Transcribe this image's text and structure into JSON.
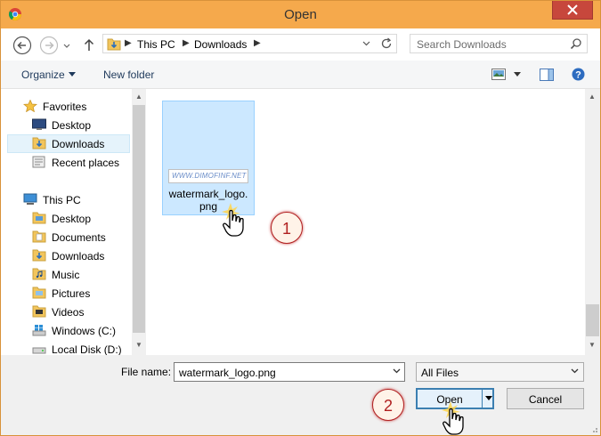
{
  "window": {
    "title": "Open",
    "app_icon": "chrome-icon"
  },
  "nav": {
    "breadcrumb": [
      "This PC",
      "Downloads"
    ],
    "search_placeholder": "Search Downloads"
  },
  "toolbar": {
    "organize_label": "Organize",
    "new_folder_label": "New folder"
  },
  "sidebar": {
    "favorites": {
      "label": "Favorites",
      "icon": "star-icon"
    },
    "favorites_items": [
      {
        "label": "Desktop",
        "icon": "desktop-icon"
      },
      {
        "label": "Downloads",
        "icon": "downloads-folder-icon",
        "selected": true
      },
      {
        "label": "Recent places",
        "icon": "recent-places-icon"
      }
    ],
    "this_pc": {
      "label": "This PC",
      "icon": "computer-icon"
    },
    "this_pc_items": [
      {
        "label": "Desktop",
        "icon": "folder-icon"
      },
      {
        "label": "Documents",
        "icon": "folder-icon"
      },
      {
        "label": "Downloads",
        "icon": "downloads-folder-icon"
      },
      {
        "label": "Music",
        "icon": "music-folder-icon"
      },
      {
        "label": "Pictures",
        "icon": "folder-icon"
      },
      {
        "label": "Videos",
        "icon": "video-folder-icon"
      },
      {
        "label": "Windows (C:)",
        "icon": "windows-drive-icon"
      },
      {
        "label": "Local Disk (D:)",
        "icon": "disk-drive-icon"
      }
    ]
  },
  "files": [
    {
      "name": "watermark_logo.png",
      "name_line1": "watermark_logo.",
      "name_line2": "png",
      "thumb_text": "WWW.DIMOFINF.NET",
      "selected": true
    }
  ],
  "footer": {
    "file_name_label": "File name:",
    "file_name_value": "watermark_logo.png",
    "file_type_value": "All Files",
    "open_label": "Open",
    "cancel_label": "Cancel"
  },
  "annotations": [
    {
      "number": "1"
    },
    {
      "number": "2"
    }
  ],
  "colors": {
    "titlebar": "#f5a94c",
    "selection": "#cce8ff",
    "close": "#c7473c",
    "annotation": "#b02020"
  }
}
